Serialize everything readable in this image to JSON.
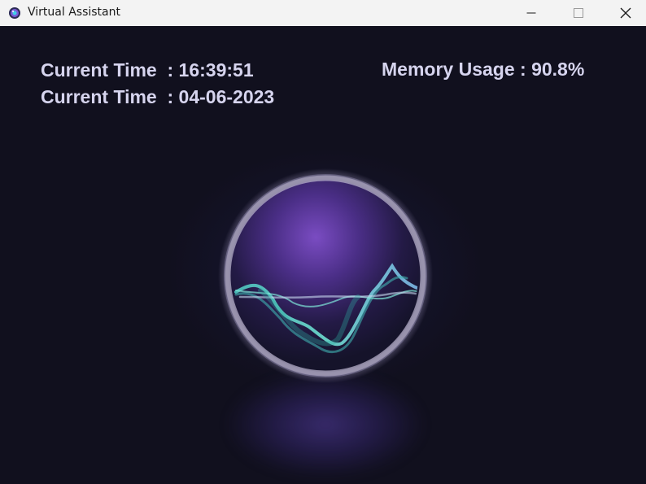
{
  "window": {
    "title": "Virtual Assistant",
    "icon": "assistant-app-icon",
    "controls": [
      "minimize-icon",
      "maximize-icon",
      "close-icon"
    ]
  },
  "status": {
    "time_label": "Current Time",
    "time_value": ": 16:39:51",
    "date_label": "Current Time",
    "date_value": ": 04-06-2023",
    "memory_label": "Memory Usage",
    "memory_value": ": 90.8%"
  },
  "visual": {
    "orb_icon": "voice-waveform-orb",
    "colors": {
      "background": "#11101e",
      "text": "#d6d4ee",
      "orb_rim": "#b4aec8",
      "orb_fill": "#6a3fae",
      "wave": "#5fd0c0"
    }
  }
}
